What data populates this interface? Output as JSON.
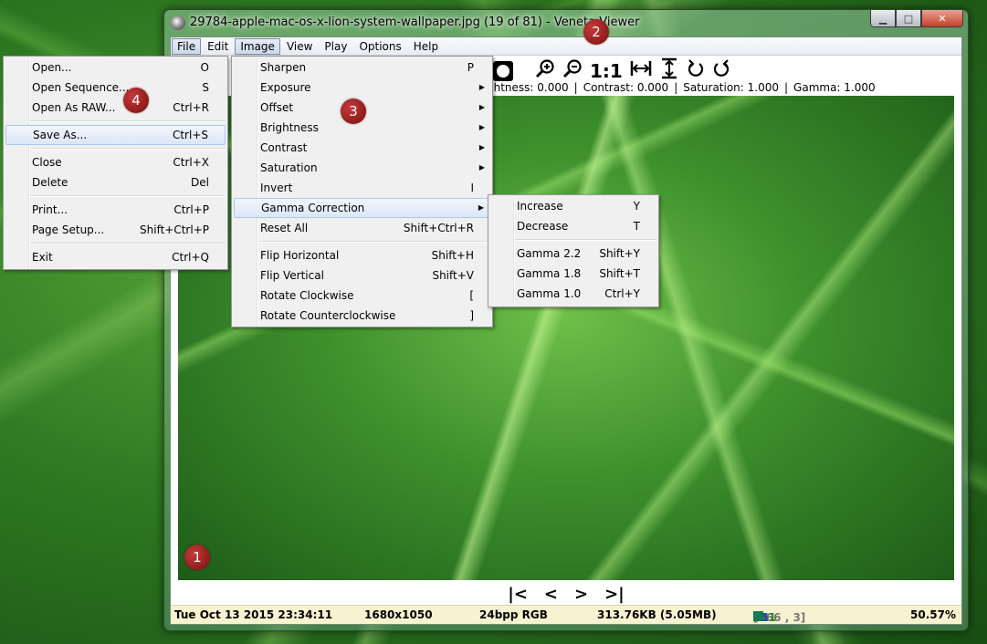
{
  "window": {
    "title": "29784-apple-mac-os-x-lion-system-wallpaper.jpg (19 of 81) - Veneta Viewer",
    "controls": {
      "minimize": "▁",
      "maximize": "□",
      "close": "✕"
    }
  },
  "menubar": [
    "File",
    "Edit",
    "Image",
    "View",
    "Play",
    "Options",
    "Help"
  ],
  "toolbar": {
    "icons": [
      "circle-icon",
      "zoom-in-icon",
      "zoom-out-icon",
      "actual-size-icon",
      "fit-width-icon",
      "fit-height-icon",
      "rotate-left-icon",
      "rotate-right-icon"
    ],
    "actual_size_label": "1:1"
  },
  "adjustments": {
    "brightness": "ghtness: 0.000",
    "contrast": "Contrast: 0.000",
    "saturation": "Saturation: 1.000",
    "gamma": "Gamma: 1.000"
  },
  "file_menu": [
    {
      "label": "Open...",
      "shortcut": "O"
    },
    {
      "label": "Open Sequence...",
      "shortcut": "S"
    },
    {
      "label": "Open As RAW...",
      "shortcut": "Ctrl+R"
    },
    {
      "label": "Save As...",
      "shortcut": "Ctrl+S"
    },
    {
      "label": "Close",
      "shortcut": "Ctrl+X"
    },
    {
      "label": "Delete",
      "shortcut": "Del"
    },
    {
      "label": "Print...",
      "shortcut": "Ctrl+P"
    },
    {
      "label": "Page Setup...",
      "shortcut": "Shift+Ctrl+P"
    },
    {
      "label": "Exit",
      "shortcut": "Ctrl+Q"
    }
  ],
  "image_menu": [
    {
      "label": "Sharpen",
      "shortcut": "P"
    },
    {
      "label": "Exposure",
      "shortcut": ""
    },
    {
      "label": "Offset",
      "shortcut": ""
    },
    {
      "label": "Brightness",
      "shortcut": ""
    },
    {
      "label": "Contrast",
      "shortcut": ""
    },
    {
      "label": "Saturation",
      "shortcut": ""
    },
    {
      "label": "Invert",
      "shortcut": "I"
    },
    {
      "label": "Gamma Correction",
      "shortcut": ""
    },
    {
      "label": "Reset All",
      "shortcut": "Shift+Ctrl+R"
    },
    {
      "label": "Flip Horizontal",
      "shortcut": "Shift+H"
    },
    {
      "label": "Flip Vertical",
      "shortcut": "Shift+V"
    },
    {
      "label": "Rotate Clockwise",
      "shortcut": "["
    },
    {
      "label": "Rotate Counterclockwise",
      "shortcut": "]"
    }
  ],
  "gamma_menu": [
    {
      "label": "Increase",
      "shortcut": "Y"
    },
    {
      "label": "Decrease",
      "shortcut": "T"
    },
    {
      "label": "Gamma 2.2",
      "shortcut": "Shift+Y"
    },
    {
      "label": "Gamma 1.8",
      "shortcut": "Shift+T"
    },
    {
      "label": "Gamma 1.0",
      "shortcut": "Ctrl+Y"
    }
  ],
  "nav": {
    "first": "|<",
    "prev": "<",
    "next": ">",
    "last": ">|"
  },
  "status": {
    "datetime": "Tue Oct 13 2015 23:34:11",
    "dimensions": "1680x1050",
    "format": "24bpp RGB",
    "filesize": "313.76KB (5.05MB)",
    "pixel_coord": "[466 , 3]",
    "r": "21",
    "g": "121",
    "b": "85",
    "swatch_color": "#157a55",
    "zoom": "50.57%"
  },
  "annotations": [
    "1",
    "2",
    "3",
    "4"
  ]
}
